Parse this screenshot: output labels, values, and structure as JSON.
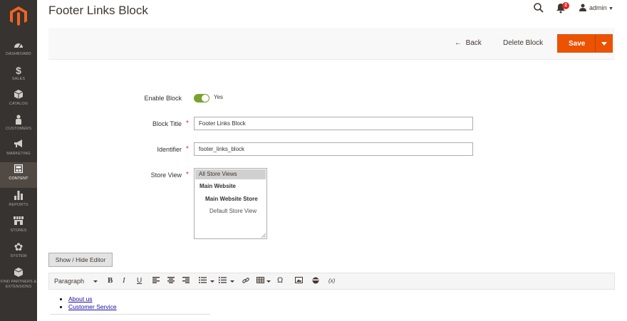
{
  "header": {
    "title": "Footer Links Block",
    "notification_count": "2",
    "user_name": "admin"
  },
  "sidebar": {
    "items": [
      {
        "label": "Dashboard",
        "icon": "dashboard-icon"
      },
      {
        "label": "Sales",
        "icon": "dollar-icon"
      },
      {
        "label": "Catalog",
        "icon": "cube-icon"
      },
      {
        "label": "Customers",
        "icon": "person-icon"
      },
      {
        "label": "Marketing",
        "icon": "megaphone-icon"
      },
      {
        "label": "Content",
        "icon": "layout-icon",
        "active": true
      },
      {
        "label": "Reports",
        "icon": "bar-chart-icon"
      },
      {
        "label": "Stores",
        "icon": "store-icon"
      },
      {
        "label": "System",
        "icon": "gear-icon"
      },
      {
        "label": "Find Partners & Extensions",
        "icon": "box-icon"
      }
    ]
  },
  "actions": {
    "back_label": "Back",
    "delete_label": "Delete Block",
    "save_label": "Save"
  },
  "form": {
    "enable_label": "Enable Block",
    "enable_value": "Yes",
    "title_label": "Block Title",
    "title_value": "Footer Links Block",
    "identifier_label": "Identifier",
    "identifier_value": "footer_links_block",
    "store_view_label": "Store View",
    "store_view_options": [
      {
        "label": "All Store Views",
        "selected": true
      },
      {
        "label": "Main Website"
      },
      {
        "label": "Main Website Store"
      },
      {
        "label": "Default Store View"
      }
    ]
  },
  "editor": {
    "toggle_label": "Show / Hide Editor",
    "format_label": "Paragraph",
    "variable_label": "(x)",
    "links": [
      "About us",
      "Customer Service"
    ]
  },
  "colors": {
    "sidebar_bg": "#373330",
    "sidebar_active": "#514943",
    "accent": "#eb5202",
    "toggle_on": "#79a22e",
    "badge": "#e22626"
  }
}
